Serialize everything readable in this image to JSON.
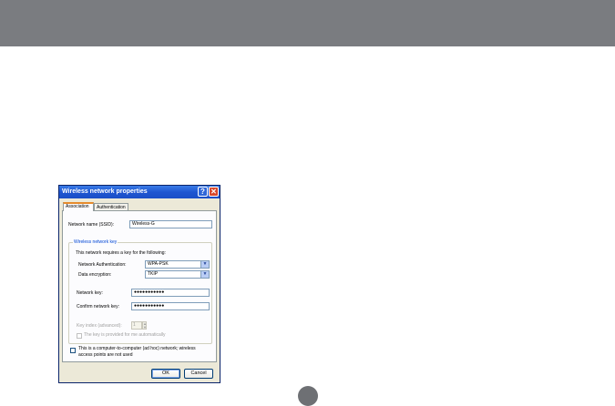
{
  "dialog": {
    "title": "Wireless network properties",
    "help_symbol": "?",
    "close_symbol": "✕",
    "tabs": [
      {
        "label": "Association",
        "active": true
      },
      {
        "label": "Authentication",
        "active": false
      }
    ],
    "ssid": {
      "label": "Network name (SSID):",
      "value": "Wireless-G"
    },
    "key_group": {
      "title": "Wireless network key",
      "description": "This network requires a key for the following:",
      "auth": {
        "label": "Network Authentication:",
        "value": "WPA-PSK"
      },
      "encryption": {
        "label": "Data encryption:",
        "value": "TKIP"
      },
      "network_key": {
        "label": "Network key:",
        "value": "●●●●●●●●●●●"
      },
      "confirm_key": {
        "label": "Confirm network key:",
        "value": "●●●●●●●●●●●"
      },
      "key_index": {
        "label": "Key index (advanced):",
        "value": "1"
      },
      "auto_key_label": "The key is provided for me automatically"
    },
    "adhoc_label_line1": "This is a computer-to-computer (ad hoc) network; wireless",
    "adhoc_label_line2": "access points are not used",
    "ok_label": "OK",
    "cancel_label": "Cancel",
    "combo_arrow": "▼",
    "spin_up": "▲",
    "spin_down": "▼"
  },
  "colors": {
    "top_band": "#7a7c80",
    "title_bar": "#1f56d1",
    "dialog_face": "#ece9d8",
    "group_title": "#0046d5"
  }
}
